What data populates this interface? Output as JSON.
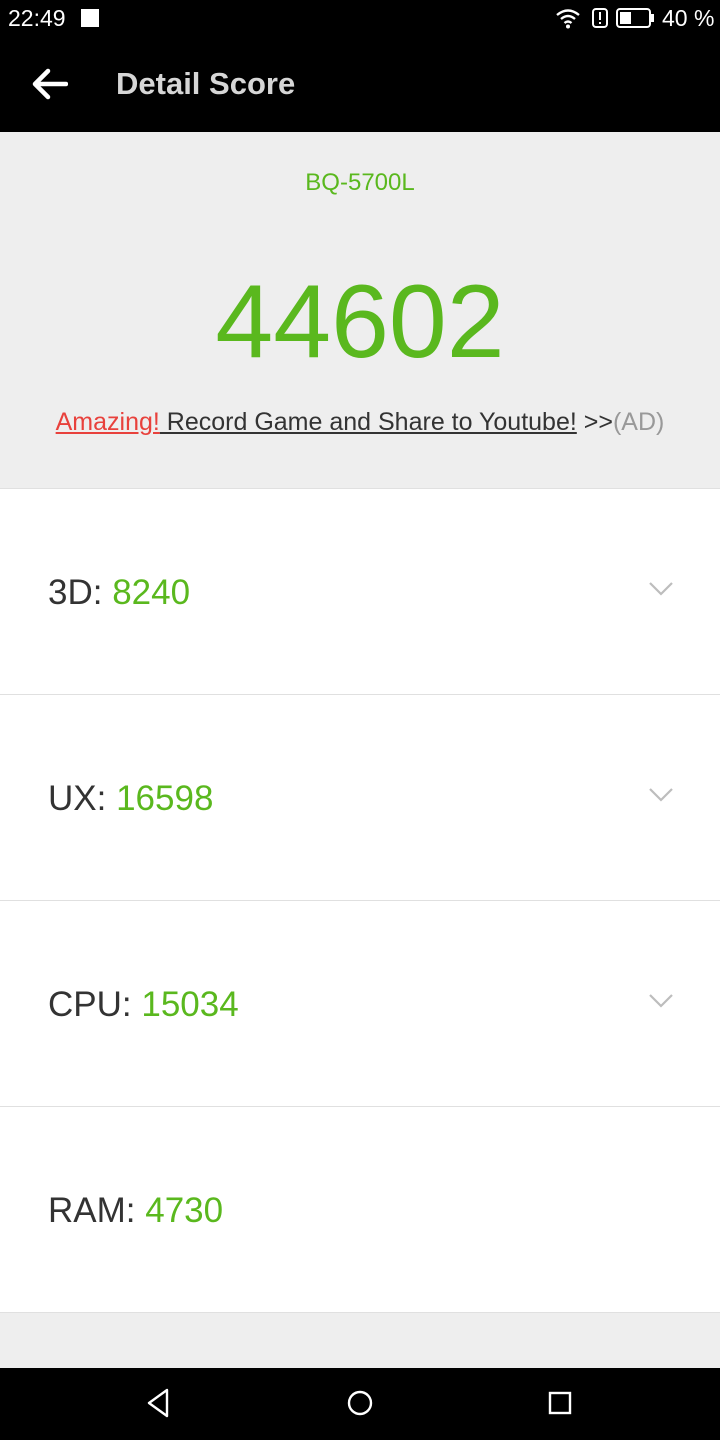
{
  "status_bar": {
    "time": "22:49",
    "battery_percent": "40 %",
    "battery_level": 0.4,
    "icons": [
      "notification-square-icon",
      "wifi-icon",
      "alert-icon",
      "battery-icon"
    ]
  },
  "app_bar": {
    "title": "Detail Score",
    "back_icon": "back-arrow-icon"
  },
  "summary": {
    "device_name": "BQ-5700L",
    "total_score": "44602",
    "ad": {
      "highlight": "Amazing!",
      "text": " Record Game and Share to Youtube!",
      "arrows": " >>",
      "tag": "(AD)"
    }
  },
  "scores": [
    {
      "label": "3D: ",
      "value": "8240",
      "expandable": true
    },
    {
      "label": "UX: ",
      "value": "16598",
      "expandable": true
    },
    {
      "label": "CPU: ",
      "value": "15034",
      "expandable": true
    },
    {
      "label": "RAM: ",
      "value": "4730",
      "expandable": false
    }
  ],
  "nav_bar": {
    "buttons": [
      "back-triangle-icon",
      "home-circle-icon",
      "recents-square-icon"
    ]
  },
  "colors": {
    "accent_green": "#5ab81e",
    "ad_red": "#e8413c",
    "header_bg": "#eeeeee",
    "bar_bg": "#000000"
  }
}
